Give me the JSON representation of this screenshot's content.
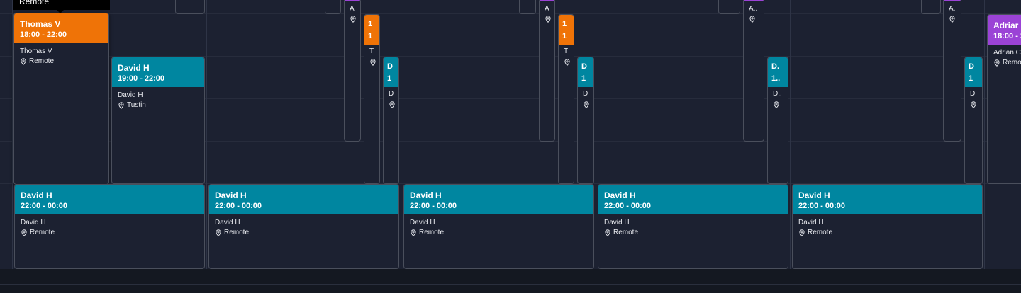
{
  "tooltip": {
    "text": "Remote"
  },
  "colors": {
    "teal": "#0086a0",
    "orange": "#ef7307",
    "purple": "#9b43d6",
    "background": "#1c2131"
  },
  "events": {
    "thomas": {
      "title": "Thomas V",
      "time": "18:00 - 22:00",
      "person": "Thomas V",
      "location": "Remote",
      "color": "orange"
    },
    "david_tustin": {
      "title": "David H",
      "time": "19:00 - 22:00",
      "person": "David H",
      "location": "Tustin",
      "color": "teal"
    },
    "late": [
      {
        "title": "David H",
        "time": "22:00 - 00:00",
        "person": "David H",
        "location": "Remote",
        "color": "teal"
      },
      {
        "title": "David H",
        "time": "22:00 - 00:00",
        "person": "David H",
        "location": "Remote",
        "color": "teal"
      },
      {
        "title": "David H",
        "time": "22:00 - 00:00",
        "person": "David H",
        "location": "Remote",
        "color": "teal"
      },
      {
        "title": "David H",
        "time": "22:00 - 00:00",
        "person": "David H",
        "location": "Remote",
        "color": "teal"
      },
      {
        "title": "David H",
        "time": "22:00 - 00:00",
        "person": "David H",
        "location": "Remote",
        "color": "teal"
      }
    ],
    "adrian": {
      "title": "Adriar",
      "time": "18:00 - 2",
      "person": "Adrian C",
      "location": "Remo",
      "color": "purple"
    }
  },
  "truncated": {
    "purple_a": [
      "A",
      "A",
      "A..",
      "A."
    ],
    "orange_1": [
      "1",
      "1",
      "T"
    ],
    "teal_d": [
      [
        "D",
        "1",
        "D"
      ],
      [
        "D",
        "1",
        "D"
      ],
      [
        "D.",
        "1..",
        "D.."
      ],
      [
        "D",
        "1",
        "D"
      ]
    ]
  }
}
